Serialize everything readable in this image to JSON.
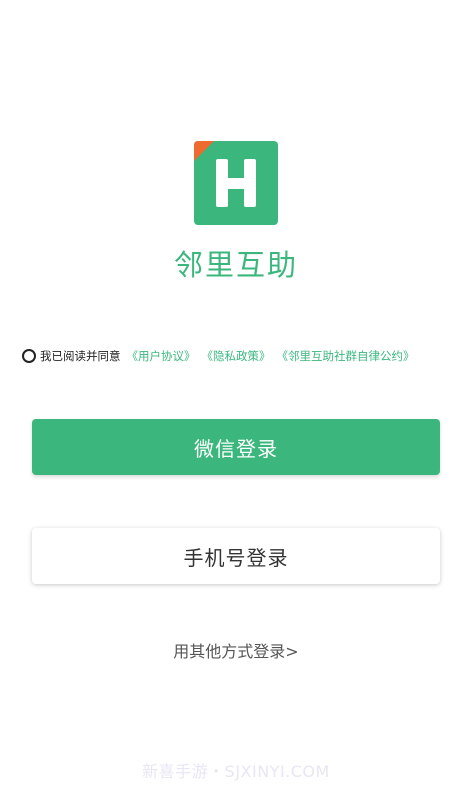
{
  "app": {
    "name": "邻里互助",
    "logo_icon": "h-logo-icon",
    "colors": {
      "brand_green": "#3bb77e",
      "logo_corner": "#ef6a2e"
    }
  },
  "agreement": {
    "prefix": "我已阅读并同意",
    "links": [
      "《用户协议》",
      "《隐私政策》",
      "《邻里互助社群自律公约》"
    ]
  },
  "buttons": {
    "wechat_login": "微信登录",
    "phone_login": "手机号登录"
  },
  "other_login": "用其他方式登录>",
  "watermark": "新喜手游・SJXINYI.COM"
}
